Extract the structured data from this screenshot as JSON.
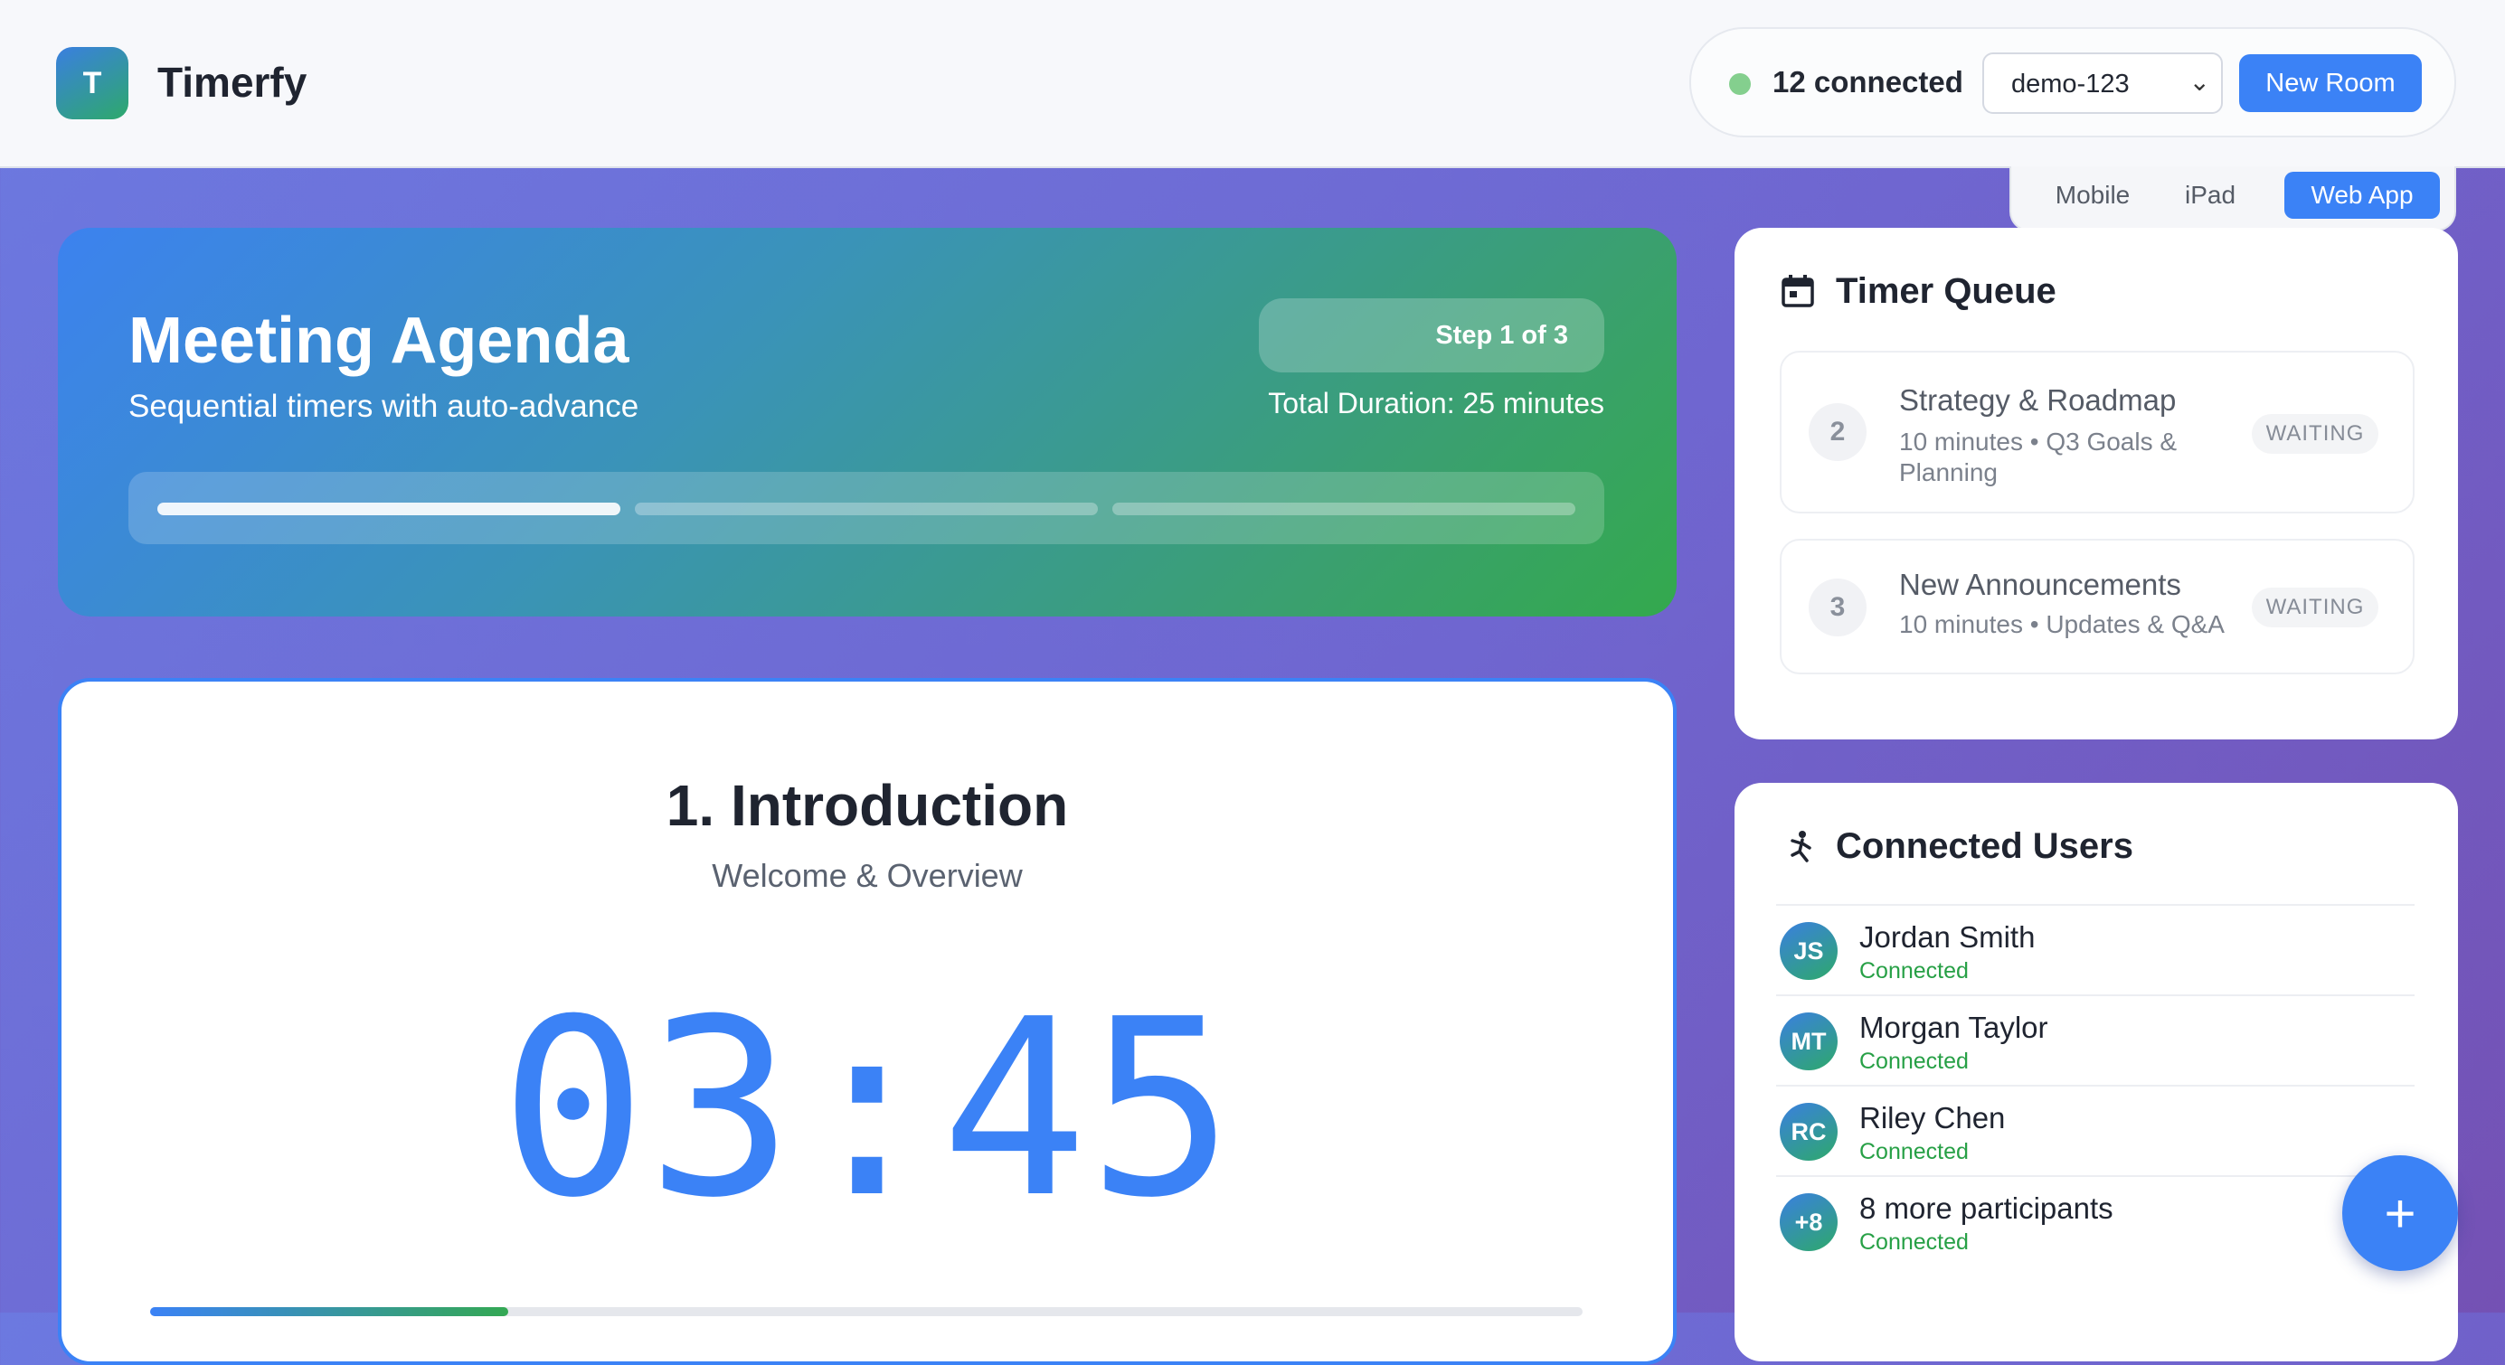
{
  "app": {
    "logo_letter": "T",
    "name": "Timerfy"
  },
  "connection": {
    "count_label": "12 connected",
    "room_value": "demo-123",
    "new_room_label": "New Room"
  },
  "view_tabs": [
    "Mobile",
    "iPad",
    "Web App"
  ],
  "agenda": {
    "title": "Meeting Agenda",
    "subtitle": "Sequential timers with auto-advance",
    "step_label": "Step 1 of 3",
    "total_duration": "Total Duration: 25 minutes",
    "segments_total": 3,
    "current_segment": 1
  },
  "current_timer": {
    "title": "1. Introduction",
    "subtitle": "Welcome & Overview",
    "time": "03:45",
    "progress": 0.25
  },
  "queue": {
    "title": "Timer Queue",
    "items": [
      {
        "number": "2",
        "title": "Strategy & Roadmap",
        "meta": "10 minutes • Q3 Goals & Planning",
        "status": "WAITING"
      },
      {
        "number": "3",
        "title": "New Announcements",
        "meta": "10 minutes • Updates & Q&A",
        "status": "WAITING"
      }
    ]
  },
  "users": {
    "title": "Connected Users",
    "list": [
      {
        "initials": "JS",
        "name": "Jordan Smith",
        "status": "Connected"
      },
      {
        "initials": "MT",
        "name": "Morgan Taylor",
        "status": "Connected"
      },
      {
        "initials": "RC",
        "name": "Riley Chen",
        "status": "Connected"
      },
      {
        "initials": "+8",
        "name": "8 more participants",
        "status": "Connected"
      }
    ]
  },
  "fab_label": "+",
  "icons": {
    "queue": "calendar-icon",
    "users": "users-icon",
    "fab": "plus-icon",
    "select": "chevron-down-icon"
  },
  "colors": {
    "accent": "#3b82f6",
    "success": "#27a046",
    "status_dot": "#84cf8e"
  }
}
